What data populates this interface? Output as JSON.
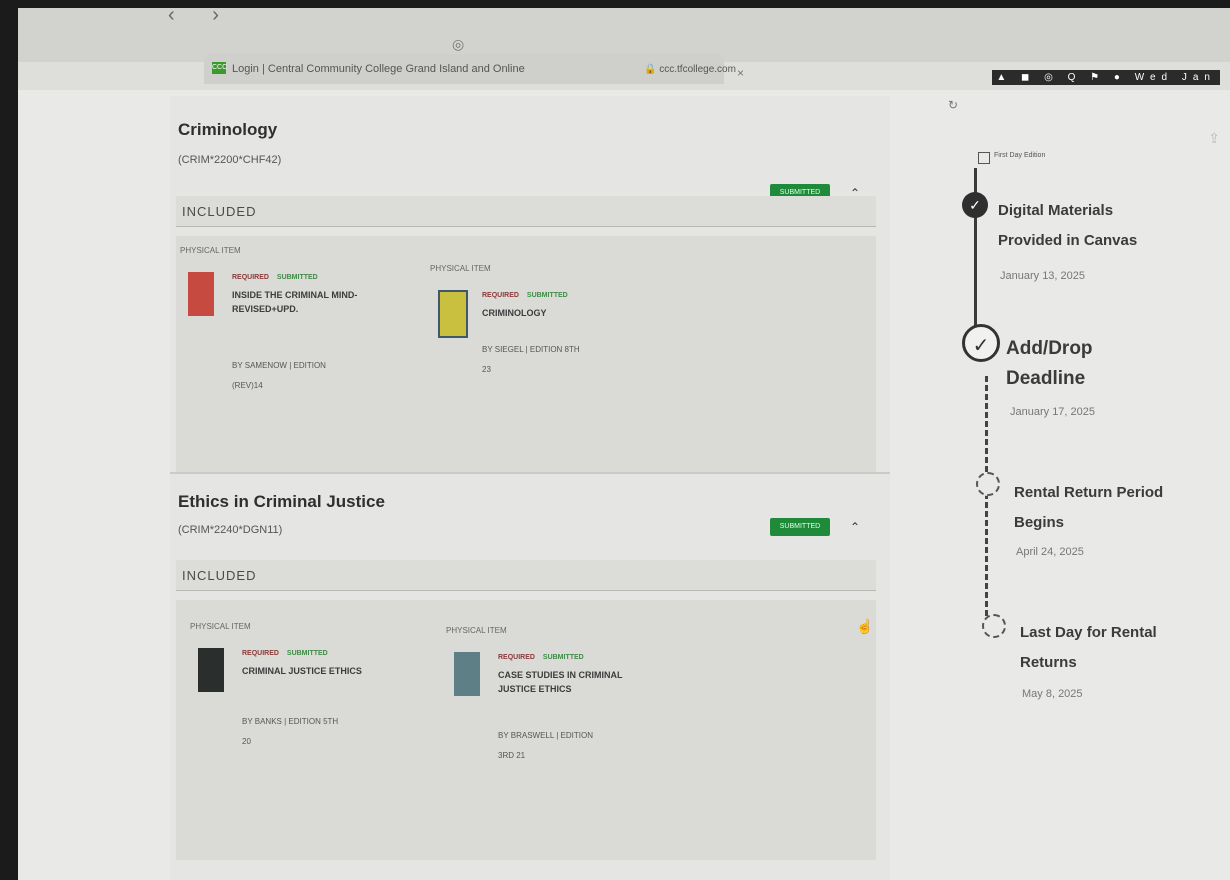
{
  "browser": {
    "tab_title": "Login | Central Community College Grand Island and Online",
    "tab_favicon": "CCC",
    "url": "🔒 ccc.tfcollege.com",
    "nav_arrows": "‹ ›",
    "tray_icons": "▲ ◼ ◎ Q ⚑ ● Wed Jan",
    "icons": [
      "lightbulb-icon",
      "reload-icon",
      "share-icon",
      "close-icon"
    ]
  },
  "courses": [
    {
      "title": "Criminology",
      "code": "(CRIM*2200*CHF42)",
      "status": "SUBMITTED",
      "included_label": "INCLUDED",
      "items": [
        {
          "type": "PHYSICAL ITEM",
          "cover_color": "#c64a3f",
          "required": "REQUIRED",
          "submitted": "SUBMITTED",
          "title": "INSIDE THE CRIMINAL MIND-REVISED+UPD.",
          "meta1": "BY SAMENOW  |  EDITION",
          "meta2": "(REV)14"
        },
        {
          "type": "PHYSICAL ITEM",
          "cover_color": "#c9c040",
          "required": "REQUIRED",
          "submitted": "SUBMITTED",
          "title": "CRIMINOLOGY",
          "meta1": "BY SIEGEL  |  EDITION 8TH",
          "meta2": "23"
        }
      ]
    },
    {
      "title": "Ethics in Criminal Justice",
      "code": "(CRIM*2240*DGN11)",
      "status": "SUBMITTED",
      "included_label": "INCLUDED",
      "items": [
        {
          "type": "PHYSICAL ITEM",
          "cover_color": "#2a2f2e",
          "required": "REQUIRED",
          "submitted": "SUBMITTED",
          "title": "CRIMINAL JUSTICE ETHICS",
          "meta1": "BY BANKS  |  EDITION 5TH",
          "meta2": "20"
        },
        {
          "type": "PHYSICAL ITEM",
          "cover_color": "#5f7f86",
          "required": "REQUIRED",
          "submitted": "SUBMITTED",
          "title": "CASE STUDIES IN CRIMINAL JUSTICE ETHICS",
          "meta1": "BY BRASWELL  |  EDITION",
          "meta2": "3RD 21"
        }
      ]
    }
  ],
  "timeline": {
    "header": "First Day Edition",
    "events": [
      {
        "title": "Digital Materials Provided in Canvas",
        "date": "January 13, 2025",
        "state": "done"
      },
      {
        "title": "Add/Drop Deadline",
        "date": "January 17, 2025",
        "state": "current"
      },
      {
        "title": "Rental Return Period Begins",
        "date": "April 24, 2025",
        "state": "upcoming"
      },
      {
        "title": "Last Day for Rental Returns",
        "date": "May 8, 2025",
        "state": "upcoming"
      }
    ]
  }
}
